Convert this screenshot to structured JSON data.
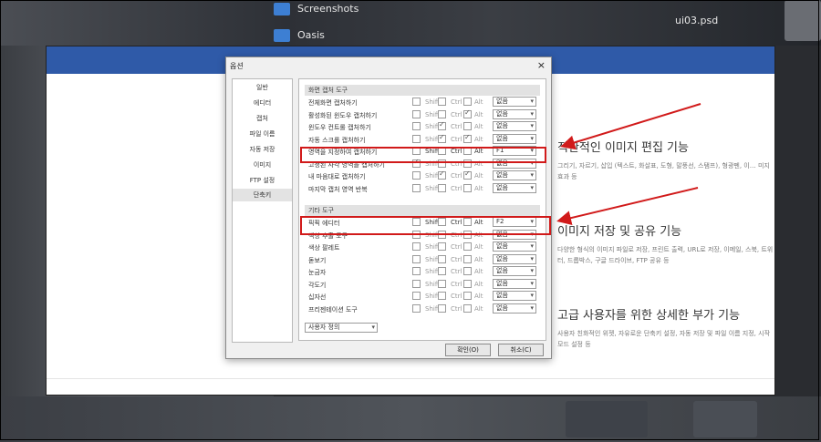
{
  "desktop": {
    "items": [
      {
        "label": "Screenshots"
      },
      {
        "label": "Oasis"
      },
      {
        "label": "ui03.psd"
      }
    ]
  },
  "features": [
    {
      "title": "직관적인 이미지 편집 기능",
      "desc": "그리기, 자르기, 삽입 (텍스트, 화살표, 도형, 말풍선, 스탬프), 형광펜, 이… 미지 효과 등"
    },
    {
      "title": "이미지 저장 및 공유 기능",
      "desc": "다양한 형식의 이미지 파일로 저장, 프린트 출력, URL로 저장, 이메일, 스북, 트위터, 드롭박스, 구글 드라이브, FTP 공유 등"
    },
    {
      "title": "고급 사용자를 위한 상세한 부가 기능",
      "desc": "사용자 친화적인 위젯, 자유로운 단축키 설정, 자동 저장 및 파일 이름 지정, 시작 모드 설정 등"
    }
  ],
  "dialog": {
    "title": "옵션",
    "close": "×",
    "nav": [
      "일반",
      "에디터",
      "캡처",
      "파일 이름",
      "자동 저장",
      "이미지",
      "FTP 설정",
      "단축키"
    ],
    "active_nav": "단축키",
    "modifiers": {
      "shift": "Shift",
      "ctrl": "Ctrl",
      "alt": "Alt"
    },
    "dropdown_arrow": "▾",
    "sections": [
      {
        "title": "화면 캡처 도구",
        "rows": [
          {
            "label": "전체화면 캡처하기",
            "key": "없음"
          },
          {
            "label": "활성화된 윈도우 캡처하기",
            "key": "없음"
          },
          {
            "label": "윈도우 컨트롤 캡처하기",
            "key": "없음"
          },
          {
            "label": "자동 스크롤 캡처하기",
            "key": "없음"
          },
          {
            "label": "영역을 지정하여 캡처하기",
            "key": "F1"
          },
          {
            "label": "고정된 사각 영역을 캡처하기",
            "key": "없음"
          },
          {
            "label": "내 마음대로 캡처하기",
            "key": "없음"
          },
          {
            "label": "마지막 캡처 영역 반복",
            "key": "없음"
          }
        ]
      },
      {
        "title": "기타 도구",
        "rows": [
          {
            "label": "픽픽 에디터",
            "key": "F2"
          },
          {
            "label": "색상 추출 도구",
            "key": "없음"
          },
          {
            "label": "색상 팔레트",
            "key": "없음"
          },
          {
            "label": "돋보기",
            "key": "없음"
          },
          {
            "label": "눈금자",
            "key": "없음"
          },
          {
            "label": "각도기",
            "key": "없음"
          },
          {
            "label": "십자선",
            "key": "없음"
          },
          {
            "label": "프리젠테이션 도구",
            "key": "없음"
          }
        ]
      }
    ],
    "custom_select": "사용자 정의",
    "ok": "확인(O)",
    "cancel": "취소(C)"
  },
  "colors": {
    "header": "#2f5aa8",
    "highlight": "#d11a1a"
  }
}
